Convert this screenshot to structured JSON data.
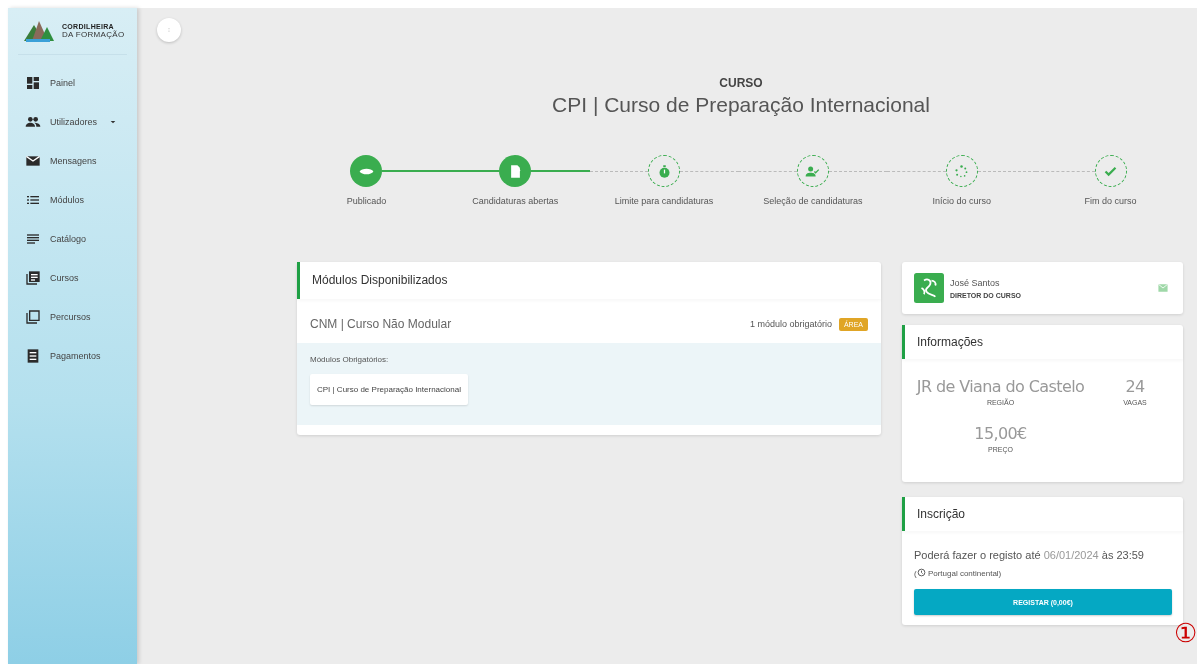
{
  "sidebar": {
    "logo": {
      "line1": "CORDILHEIRA",
      "line2": "DA FORMAÇÃO"
    },
    "items": [
      {
        "label": "Painel",
        "selected": false,
        "submenu": false
      },
      {
        "label": "Utilizadores",
        "selected": false,
        "submenu": true
      },
      {
        "label": "Mensagens",
        "selected": false,
        "submenu": false
      },
      {
        "label": "Módulos",
        "selected": false,
        "submenu": false
      },
      {
        "label": "Catálogo",
        "selected": false,
        "submenu": false
      },
      {
        "label": "Cursos",
        "selected": false,
        "submenu": false
      },
      {
        "label": "Percursos",
        "selected": false,
        "submenu": false
      },
      {
        "label": "Pagamentos",
        "selected": false,
        "submenu": false
      }
    ]
  },
  "header": {
    "kicker": "CURSO",
    "title": "CPI | Curso de Preparação Internacional"
  },
  "steps": [
    {
      "label": "Publicado",
      "done": true
    },
    {
      "label": "Candidaturas abertas",
      "done": true
    },
    {
      "label": "Limite para candidaturas",
      "done": false
    },
    {
      "label": "Seleção de candidaturas",
      "done": false
    },
    {
      "label": "Início do curso",
      "done": false
    },
    {
      "label": "Fim do curso",
      "done": false
    }
  ],
  "modules_card": {
    "title": "Módulos Disponibilizados",
    "group": {
      "name": "CNM | Curso Não Modular",
      "count": "1 módulo obrigatório",
      "tag": "ÁREA"
    },
    "required_label": "Módulos Obrigatórios:",
    "required_items": [
      "CPI | Curso de Preparação Internacional"
    ]
  },
  "director": {
    "name": "José Santos",
    "role": "DIRETOR DO CURSO"
  },
  "info_card": {
    "title": "Informações",
    "fields": [
      {
        "value": "JR de Viana do Castelo",
        "label": "REGIÃO"
      },
      {
        "value": "24",
        "label": "VAGAS"
      },
      {
        "value": "15,00€",
        "label": "PREÇO"
      }
    ]
  },
  "registration_card": {
    "title": "Inscrição",
    "text_before": "Poderá fazer o registo até",
    "date": "06/01/2024",
    "text_after": "às",
    "time": "23:59",
    "timezone_open": "(",
    "timezone": "Portugal continental)",
    "button": "REGISTAR (0,00€)"
  },
  "annotation_marker": "①"
}
